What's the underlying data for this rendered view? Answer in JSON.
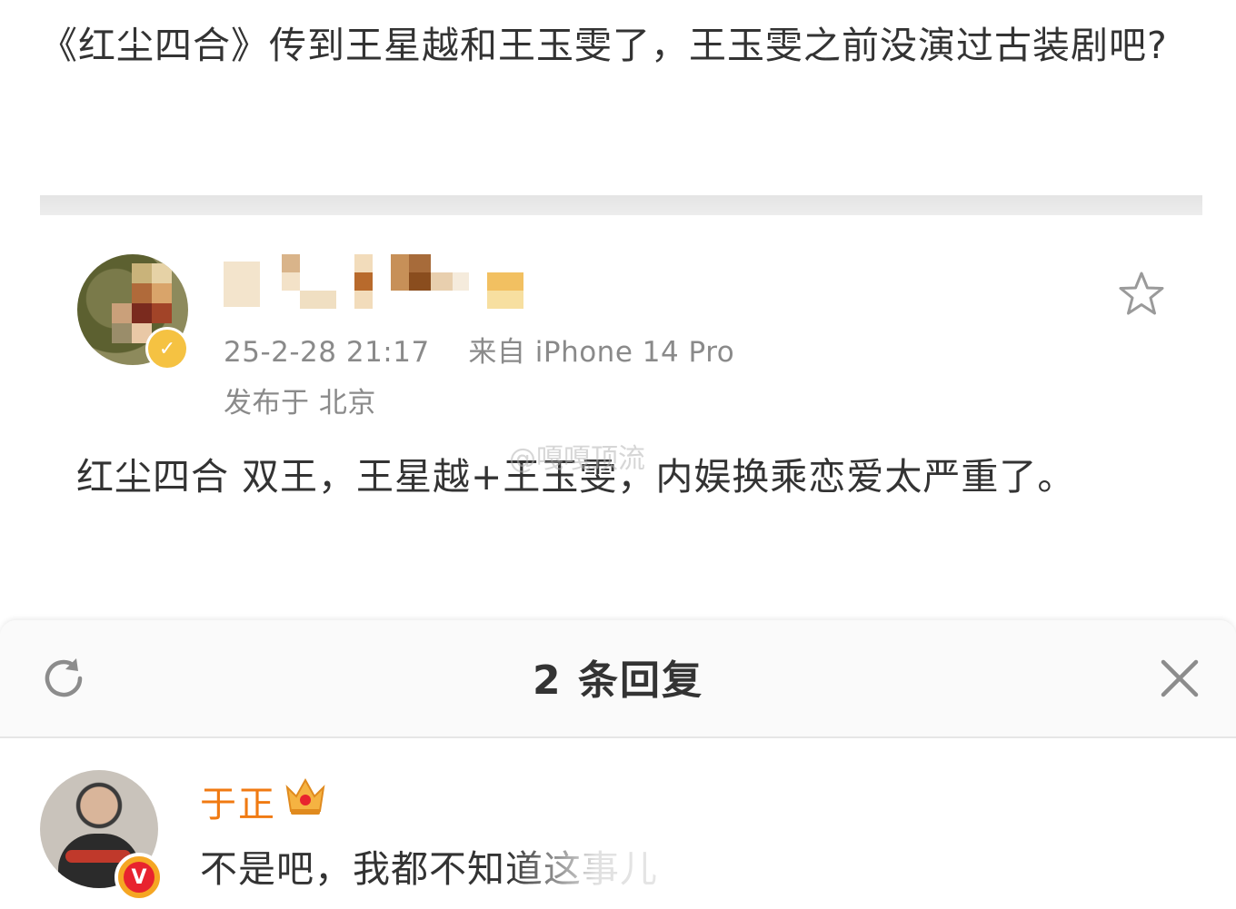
{
  "post": {
    "text": "《红尘四合》传到王星越和王玉雯了，王玉雯之前没演过古装剧吧?"
  },
  "comment": {
    "meta_date": "25-2-28 21:17",
    "meta_source": "来自 iPhone 14 Pro",
    "meta_location": "发布于 北京",
    "text": "红尘四合 双王，王星越+王玉雯，内娱换乘恋爱太严重了。",
    "watermark": "@嘎嘎顶流"
  },
  "reply_sheet": {
    "title": "2 条回复",
    "replies": [
      {
        "name": "于正",
        "text": "不是吧，我都不知道这事儿"
      }
    ]
  },
  "icons": {
    "star": "star-outline-icon",
    "refresh": "refresh-icon",
    "close": "close-icon",
    "crown": "crown-icon",
    "verified": "verified-v-icon"
  },
  "colors": {
    "username_orange": "#f07a12",
    "verified_red": "#e8232e",
    "meta_gray": "#8a8a8a"
  }
}
